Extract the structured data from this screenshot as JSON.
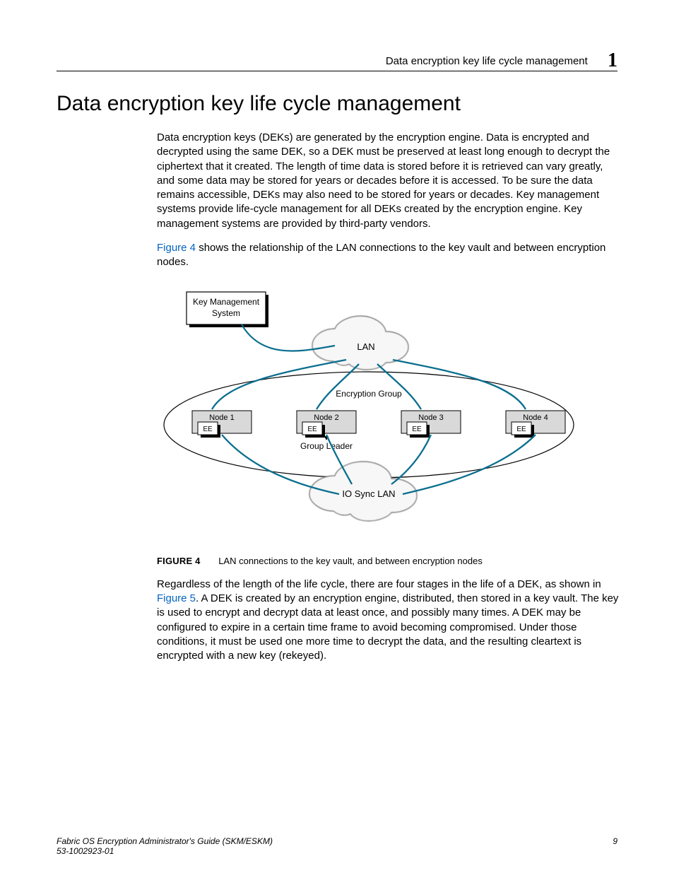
{
  "header": {
    "running_title": "Data encryption key life cycle management",
    "chapter_number": "1"
  },
  "section": {
    "title": "Data encryption key life cycle management"
  },
  "paragraphs": {
    "p1": "Data encryption keys (DEKs) are generated by the encryption engine. Data is encrypted and decrypted using the same DEK, so a DEK must be preserved at least long enough to decrypt the ciphertext that it created. The length of time data is stored before it is retrieved can vary greatly, and some data may be stored for years or decades before it is accessed. To be sure the data remains accessible, DEKs may also need to be stored for years or decades. Key management systems provide life-cycle management for all DEKs created by the encryption engine. Key management systems are provided by third-party vendors.",
    "p2_link": "Figure 4",
    "p2_rest": " shows the relationship of the LAN connections to the key vault and between encryption nodes.",
    "p3_lead": "Regardless of the length of the life cycle, there are four stages in the life of a DEK, as shown in ",
    "p3_link": "Figure 5",
    "p3_rest": ". A DEK is created by an encryption engine, distributed, then stored in a key vault. The key is used to encrypt and decrypt data at least once, and possibly many times. A DEK may be configured to expire in a certain time frame to avoid becoming compromised. Under those conditions, it must be used one more time to decrypt the data, and the resulting cleartext is encrypted with a new key (rekeyed)."
  },
  "figure4": {
    "number_label": "FIGURE 4",
    "caption": "LAN connections to the key vault, and between encryption nodes",
    "labels": {
      "kms_l1": "Key Management",
      "kms_l2": "System",
      "lan": "LAN",
      "encryption_group": "Encryption Group",
      "node1": "Node 1",
      "node2": "Node 2",
      "node3": "Node 3",
      "node4": "Node 4",
      "ee": "EE",
      "group_leader": "Group Leader",
      "io_sync_lan": "IO Sync LAN"
    }
  },
  "footer": {
    "doc_title": "Fabric OS Encryption Administrator's Guide (SKM/ESKM)",
    "doc_number": "53-1002923-01",
    "page_number": "9"
  }
}
